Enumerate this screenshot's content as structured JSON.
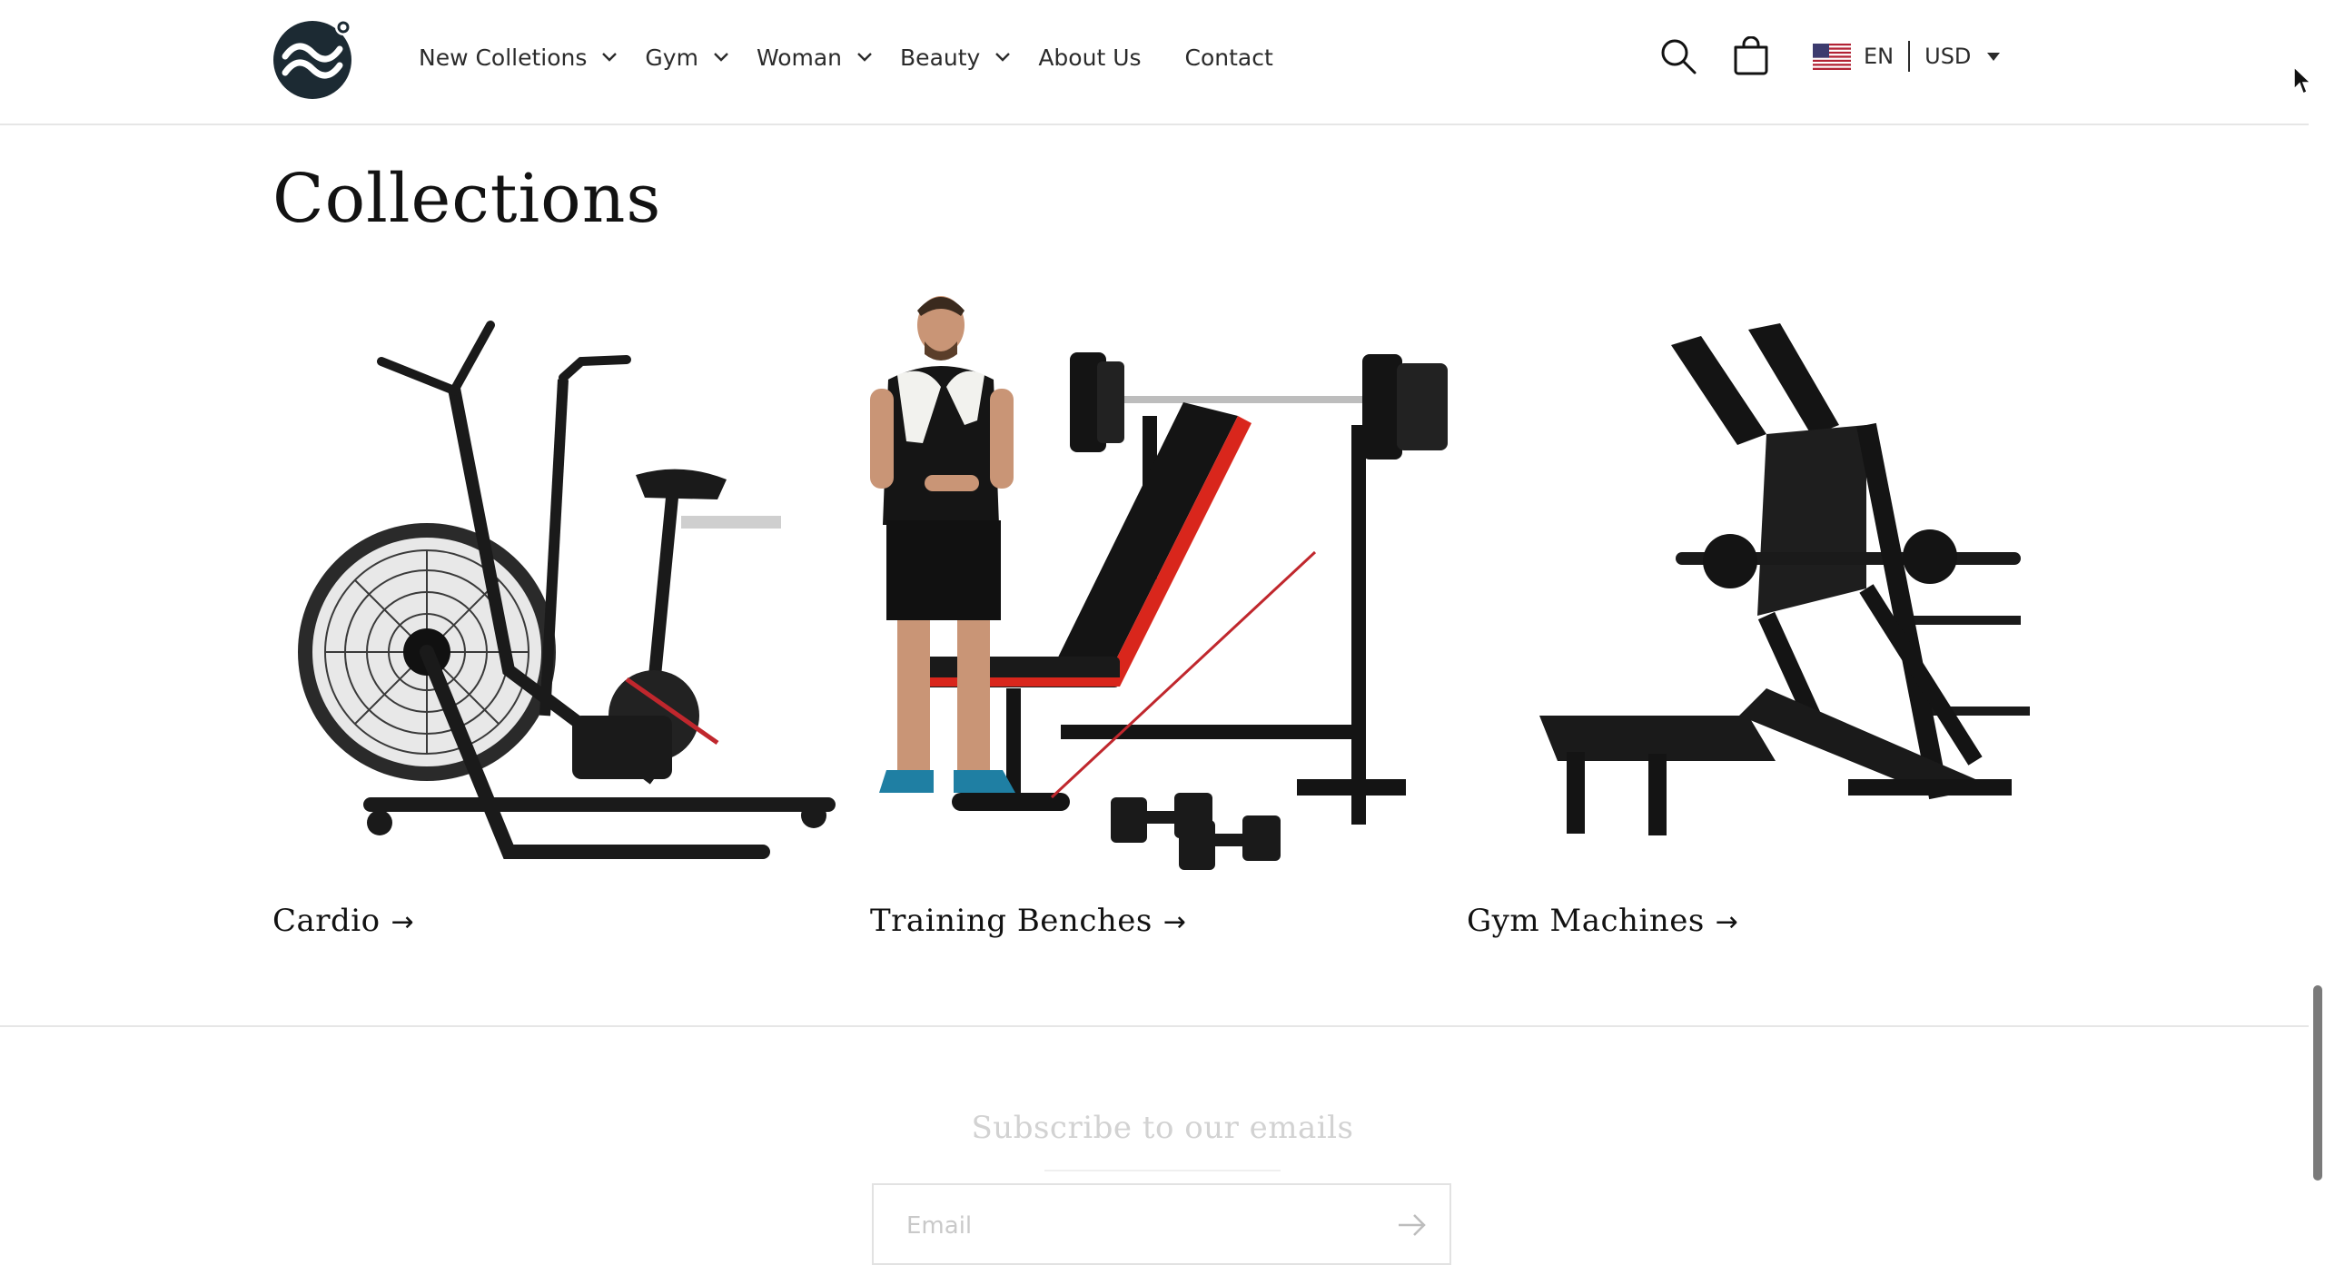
{
  "header": {
    "nav": [
      {
        "label": "New Colletions",
        "dropdown": true
      },
      {
        "label": "Gym",
        "dropdown": true
      },
      {
        "label": "Woman",
        "dropdown": true
      },
      {
        "label": "Beauty",
        "dropdown": true
      },
      {
        "label": "About Us",
        "dropdown": false
      },
      {
        "label": "Contact",
        "dropdown": false
      }
    ],
    "icons": [
      "search-icon",
      "cart-icon"
    ],
    "locale": {
      "language": "EN",
      "currency": "USD",
      "flag": "us-flag-icon"
    }
  },
  "collections": {
    "title": "Collections",
    "items": [
      {
        "label": "Cardio",
        "arrow": "→"
      },
      {
        "label": "Training Benches",
        "arrow": "→"
      },
      {
        "label": "Gym Machines",
        "arrow": "→"
      }
    ]
  },
  "newsletter": {
    "title": "Subscribe to our emails",
    "email_placeholder": "Email"
  },
  "colors": {
    "text": "#121212",
    "border": "#e6e6e6",
    "accent_red": "#d9261c",
    "logo": "#1c2a33"
  }
}
